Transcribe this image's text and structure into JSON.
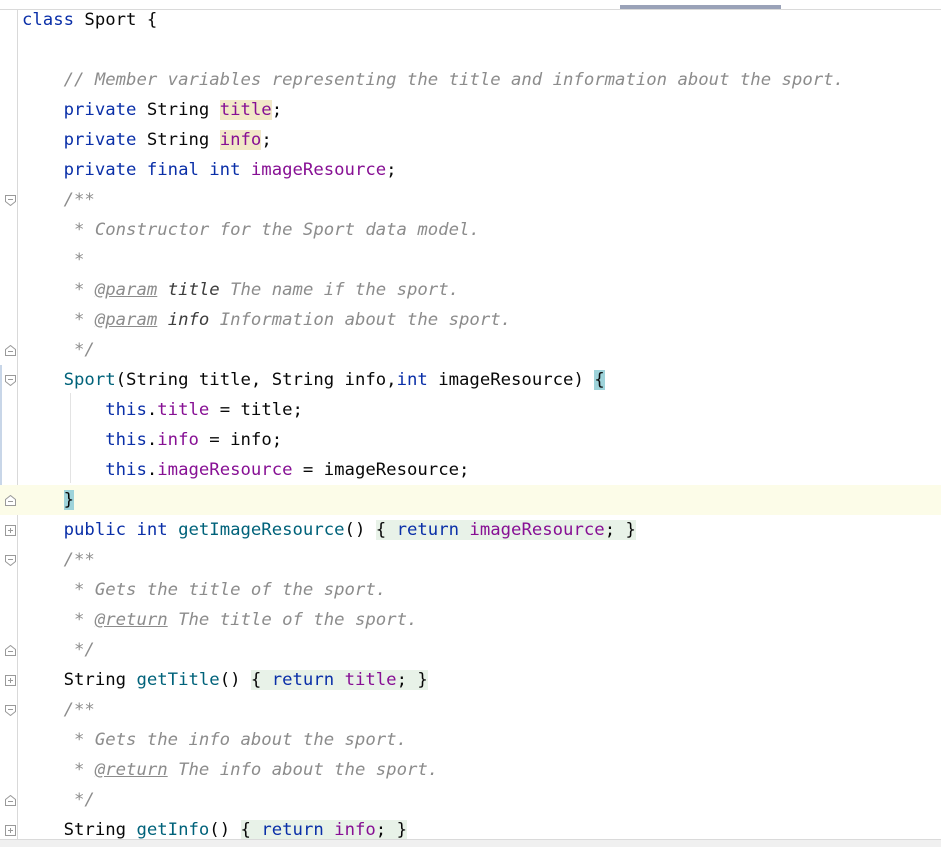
{
  "editor": {
    "lines": [
      {
        "tokens": [
          {
            "t": "class",
            "c": "kw"
          },
          {
            "t": " Sport {",
            "c": "plain"
          }
        ]
      },
      {
        "tokens": []
      },
      {
        "tokens": [
          {
            "t": "    // Member variables representing the title and information about the sport.",
            "c": "comment"
          }
        ]
      },
      {
        "tokens": [
          {
            "t": "    private",
            "c": "kw"
          },
          {
            "t": " String ",
            "c": "plain"
          },
          {
            "t": "title",
            "c": "field",
            "h": "hl"
          },
          {
            "t": ";",
            "c": "plain"
          }
        ]
      },
      {
        "tokens": [
          {
            "t": "    private",
            "c": "kw"
          },
          {
            "t": " String ",
            "c": "plain"
          },
          {
            "t": "info",
            "c": "field",
            "h": "hl"
          },
          {
            "t": ";",
            "c": "plain"
          }
        ]
      },
      {
        "tokens": [
          {
            "t": "    private final int",
            "c": "kw"
          },
          {
            "t": " ",
            "c": "plain"
          },
          {
            "t": "imageResource",
            "c": "field"
          },
          {
            "t": ";",
            "c": "plain"
          }
        ]
      },
      {
        "tokens": [
          {
            "t": "    /**",
            "c": "comment"
          }
        ]
      },
      {
        "tokens": [
          {
            "t": "     * Constructor for the Sport data model.",
            "c": "comment"
          }
        ]
      },
      {
        "tokens": [
          {
            "t": "     *",
            "c": "comment"
          }
        ]
      },
      {
        "tokens": [
          {
            "t": "     * ",
            "c": "comment"
          },
          {
            "t": "@param",
            "c": "tag"
          },
          {
            "t": " ",
            "c": "comment"
          },
          {
            "t": "title",
            "c": "pname"
          },
          {
            "t": " The name if the sport.",
            "c": "comment"
          }
        ]
      },
      {
        "tokens": [
          {
            "t": "     * ",
            "c": "comment"
          },
          {
            "t": "@param",
            "c": "tag"
          },
          {
            "t": " ",
            "c": "comment"
          },
          {
            "t": "info",
            "c": "pname"
          },
          {
            "t": " Information about the sport.",
            "c": "comment"
          }
        ]
      },
      {
        "tokens": [
          {
            "t": "     */",
            "c": "comment"
          }
        ]
      },
      {
        "tokens": [
          {
            "t": "    ",
            "c": "plain"
          },
          {
            "t": "Sport",
            "c": "method"
          },
          {
            "t": "(String title, String info,",
            "c": "plain"
          },
          {
            "t": "int",
            "c": "kw"
          },
          {
            "t": " imageResource) ",
            "c": "plain"
          },
          {
            "t": "{",
            "c": "plain",
            "h": "brace"
          }
        ]
      },
      {
        "tokens": [
          {
            "t": "        ",
            "c": "plain"
          },
          {
            "t": "this",
            "c": "kw"
          },
          {
            "t": ".",
            "c": "plain"
          },
          {
            "t": "title",
            "c": "field"
          },
          {
            "t": " = title;",
            "c": "plain"
          }
        ]
      },
      {
        "tokens": [
          {
            "t": "        ",
            "c": "plain"
          },
          {
            "t": "this",
            "c": "kw"
          },
          {
            "t": ".",
            "c": "plain"
          },
          {
            "t": "info",
            "c": "field"
          },
          {
            "t": " = info;",
            "c": "plain"
          }
        ]
      },
      {
        "tokens": [
          {
            "t": "        ",
            "c": "plain"
          },
          {
            "t": "this",
            "c": "kw"
          },
          {
            "t": ".",
            "c": "plain"
          },
          {
            "t": "imageResource",
            "c": "field"
          },
          {
            "t": " = imageResource;",
            "c": "plain"
          }
        ]
      },
      {
        "current": true,
        "tokens": [
          {
            "t": "    ",
            "c": "plain"
          },
          {
            "t": "}",
            "c": "plain",
            "h": "brace"
          }
        ]
      },
      {
        "tokens": [
          {
            "t": "    public int",
            "c": "kw"
          },
          {
            "t": " ",
            "c": "plain"
          },
          {
            "t": "getImageResource",
            "c": "method"
          },
          {
            "t": "() ",
            "c": "plain"
          },
          {
            "t": "{ ",
            "c": "plain",
            "h": "fold"
          },
          {
            "t": "return",
            "c": "kw",
            "h": "fold"
          },
          {
            "t": " ",
            "c": "plain",
            "h": "fold"
          },
          {
            "t": "imageResource",
            "c": "field",
            "h": "fold"
          },
          {
            "t": "; }",
            "c": "plain",
            "h": "fold"
          }
        ]
      },
      {
        "tokens": [
          {
            "t": "    /**",
            "c": "comment"
          }
        ]
      },
      {
        "tokens": [
          {
            "t": "     * Gets the title of the sport.",
            "c": "comment"
          }
        ]
      },
      {
        "tokens": [
          {
            "t": "     * ",
            "c": "comment"
          },
          {
            "t": "@return",
            "c": "tag"
          },
          {
            "t": " The title of the sport.",
            "c": "comment"
          }
        ]
      },
      {
        "tokens": [
          {
            "t": "     */",
            "c": "comment"
          }
        ]
      },
      {
        "tokens": [
          {
            "t": "    String ",
            "c": "plain"
          },
          {
            "t": "getTitle",
            "c": "method"
          },
          {
            "t": "() ",
            "c": "plain"
          },
          {
            "t": "{ ",
            "c": "plain",
            "h": "fold"
          },
          {
            "t": "return",
            "c": "kw",
            "h": "fold"
          },
          {
            "t": " ",
            "c": "plain",
            "h": "fold"
          },
          {
            "t": "title",
            "c": "field",
            "h": "fold"
          },
          {
            "t": "; }",
            "c": "plain",
            "h": "fold"
          }
        ]
      },
      {
        "tokens": [
          {
            "t": "    /**",
            "c": "comment"
          }
        ]
      },
      {
        "tokens": [
          {
            "t": "     * Gets the info about the sport.",
            "c": "comment"
          }
        ]
      },
      {
        "tokens": [
          {
            "t": "     * ",
            "c": "comment"
          },
          {
            "t": "@return",
            "c": "tag"
          },
          {
            "t": " The info about the sport.",
            "c": "comment"
          }
        ]
      },
      {
        "tokens": [
          {
            "t": "     */",
            "c": "comment"
          }
        ]
      },
      {
        "tokens": [
          {
            "t": "    String ",
            "c": "plain"
          },
          {
            "t": "getInfo",
            "c": "method"
          },
          {
            "t": "() ",
            "c": "plain"
          },
          {
            "t": "{ ",
            "c": "plain",
            "h": "fold"
          },
          {
            "t": "return",
            "c": "kw",
            "h": "fold"
          },
          {
            "t": " ",
            "c": "plain",
            "h": "fold"
          },
          {
            "t": "info",
            "c": "field",
            "h": "fold"
          },
          {
            "t": "; }",
            "c": "plain",
            "h": "fold"
          }
        ]
      }
    ]
  },
  "gutter": {
    "icons": [
      {
        "line": 6,
        "name": "fold-collapse-icon"
      },
      {
        "line": 11,
        "name": "fold-end-icon"
      },
      {
        "line": 12,
        "name": "fold-collapse-icon"
      },
      {
        "line": 16,
        "name": "fold-end-icon"
      },
      {
        "line": 17,
        "name": "fold-expand-icon"
      },
      {
        "line": 18,
        "name": "fold-collapse-icon"
      },
      {
        "line": 21,
        "name": "fold-end-icon"
      },
      {
        "line": 22,
        "name": "fold-expand-icon"
      },
      {
        "line": 23,
        "name": "fold-collapse-icon"
      },
      {
        "line": 26,
        "name": "fold-end-icon"
      },
      {
        "line": 27,
        "name": "fold-expand-icon"
      }
    ]
  }
}
